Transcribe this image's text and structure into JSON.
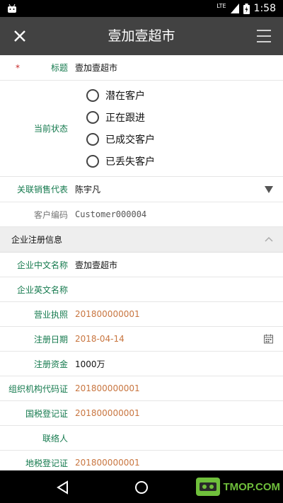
{
  "status_bar": {
    "network": "LTE",
    "time": "1:58"
  },
  "app_bar": {
    "title": "壹加壹超市",
    "close_icon": "close-icon",
    "menu_icon": "menu-icon"
  },
  "form": {
    "required_mark": "*",
    "title_label": "标题",
    "title_value": "壹加壹超市",
    "status_label": "当前状态",
    "status_options": [
      "潜在客户",
      "正在跟进",
      "已成交客户",
      "已丢失客户"
    ],
    "sales_label": "关联销售代表",
    "sales_value": "陈宇凡",
    "code_label": "客户编码",
    "code_value": "Customer000004"
  },
  "section": {
    "title": "企业注册信息",
    "fields": [
      {
        "label": "企业中文名称",
        "value": "壹加壹超市"
      },
      {
        "label": "企业英文名称",
        "value": ""
      },
      {
        "label": "营业执照",
        "value": "201800000001"
      },
      {
        "label": "注册日期",
        "value": "2018-04-14"
      },
      {
        "label": "注册资金",
        "value": "1000万"
      },
      {
        "label": "组织机构代码证",
        "value": "201800000001"
      },
      {
        "label": "国税登记证",
        "value": "201800000001"
      },
      {
        "label": "联络人",
        "value": ""
      },
      {
        "label": "地税登记证",
        "value": "201800000001"
      }
    ]
  },
  "watermark": {
    "text": "TMOP.COM"
  },
  "colors": {
    "app_bar": "#424242",
    "label_green": "#157a4e",
    "value_orange": "#c8753f",
    "required_red": "#c62828"
  }
}
